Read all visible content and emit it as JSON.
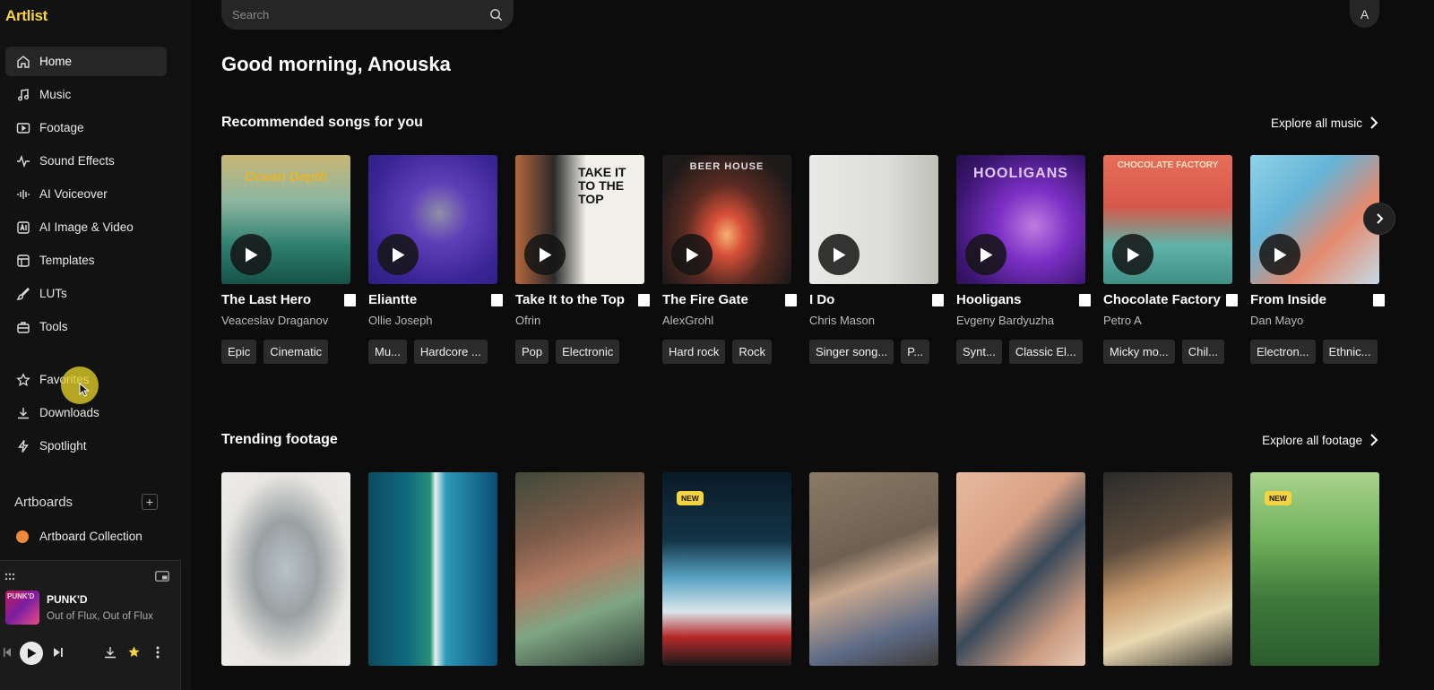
{
  "app": {
    "logo": "Artlist"
  },
  "sidebar": {
    "nav": [
      {
        "label": "Home",
        "icon": "home-icon",
        "active": true
      },
      {
        "label": "Music",
        "icon": "music-note-icon"
      },
      {
        "label": "Footage",
        "icon": "video-icon"
      },
      {
        "label": "Sound Effects",
        "icon": "waveform-icon"
      },
      {
        "label": "AI Voiceover",
        "icon": "voice-wave-icon"
      },
      {
        "label": "AI Image & Video",
        "icon": "ai-image-icon"
      },
      {
        "label": "Templates",
        "icon": "template-icon"
      },
      {
        "label": "LUTs",
        "icon": "brush-icon"
      },
      {
        "label": "Tools",
        "icon": "toolbox-icon"
      }
    ],
    "nav2": [
      {
        "label": "Favorites",
        "icon": "star-icon"
      },
      {
        "label": "Downloads",
        "icon": "download-icon"
      },
      {
        "label": "Spotlight",
        "icon": "lightning-icon"
      }
    ],
    "artboards_label": "Artboards",
    "artboard_item": "Artboard Collection"
  },
  "player": {
    "title": "PUNK'D",
    "artist": "Out of Flux, Out of Flux",
    "cover_text": "PUNK'D"
  },
  "search": {
    "placeholder": "Search"
  },
  "user": {
    "initial": "A"
  },
  "greeting": "Good morning, Anouska",
  "recommended": {
    "title": "Recommended songs for you",
    "explore": "Explore all music",
    "songs": [
      {
        "title": "The Last Hero",
        "artist": "Veaceslav Draganov",
        "tags": [
          "Epic",
          "Cinematic"
        ],
        "caption": "Ocean Depth"
      },
      {
        "title": "Eliantte",
        "artist": "Ollie Joseph",
        "tags": [
          "Mu...",
          "Hardcore ..."
        ]
      },
      {
        "title": "Take It to the Top",
        "artist": "Ofrin",
        "tags": [
          "Pop",
          "Electronic"
        ],
        "caption": "TAKE IT TO THE TOP"
      },
      {
        "title": "The Fire Gate",
        "artist": "AlexGrohl",
        "tags": [
          "Hard rock",
          "Rock"
        ],
        "caption": "BEER HOUSE"
      },
      {
        "title": "I Do",
        "artist": "Chris Mason",
        "tags": [
          "Singer song...",
          "P..."
        ]
      },
      {
        "title": "Hooligans",
        "artist": "Evgeny Bardyuzha",
        "tags": [
          "Synt...",
          "Classic El..."
        ],
        "caption": "HOOLIGANS"
      },
      {
        "title": "Chocolate Factory",
        "artist": "Petro A",
        "tags": [
          "Micky mo...",
          "Chil..."
        ],
        "caption": "CHOCOLATE FACTORY"
      },
      {
        "title": "From Inside",
        "artist": "Dan Mayo",
        "tags": [
          "Electron...",
          "Ethnic..."
        ]
      }
    ]
  },
  "trending": {
    "title": "Trending footage",
    "explore": "Explore all footage",
    "new_badge": "NEW",
    "clips": [
      {
        "new": false
      },
      {
        "new": false
      },
      {
        "new": false
      },
      {
        "new": true
      },
      {
        "new": false
      },
      {
        "new": false
      },
      {
        "new": false
      },
      {
        "new": true
      }
    ]
  },
  "colors": {
    "accent": "#f6d33c",
    "background": "#0c0c0c",
    "sidebar": "#121212"
  }
}
